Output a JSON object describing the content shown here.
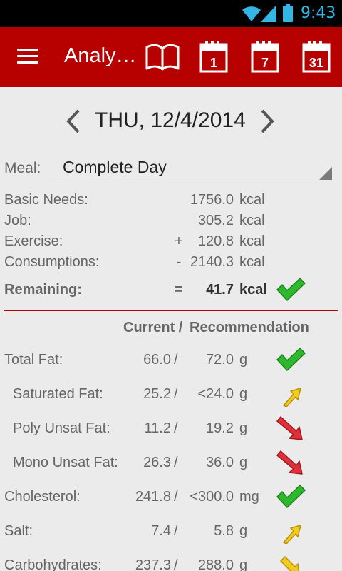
{
  "status_bar": {
    "time": "9:43",
    "icons": [
      "wifi-icon",
      "signal-icon",
      "battery-icon"
    ]
  },
  "action_bar": {
    "title": "Analy…",
    "icons": [
      "menu-icon",
      "book-icon",
      "calendar-day-icon",
      "calendar-week-icon",
      "calendar-month-icon"
    ],
    "cal_day": "1",
    "cal_week": "7",
    "cal_month": "31"
  },
  "date_nav": {
    "date": "THU, 12/4/2014"
  },
  "meal": {
    "label": "Meal:",
    "value": "Complete Day"
  },
  "balance": [
    {
      "label": "Basic Needs:",
      "sign": "",
      "value": "1756.0",
      "unit": "kcal"
    },
    {
      "label": "Job:",
      "sign": "",
      "value": "305.2",
      "unit": "kcal"
    },
    {
      "label": "Exercise:",
      "sign": "+",
      "value": "120.8",
      "unit": "kcal"
    },
    {
      "label": "Consumptions:",
      "sign": "-",
      "value": "2140.3",
      "unit": "kcal"
    },
    {
      "label": "Remaining:",
      "sign": "=",
      "value": "41.7",
      "unit": "kcal",
      "status": "good"
    }
  ],
  "columns": {
    "current": "Current /",
    "recommendation": "Recommendation"
  },
  "nutrients": [
    {
      "label": "Total Fat:",
      "current": "66.0",
      "recommended": "72.0",
      "unit": "g",
      "status": "good"
    },
    {
      "label": "Saturated Fat:",
      "current": "25.2",
      "recommended": "<24.0",
      "unit": "g",
      "status": "slightly-high"
    },
    {
      "label": "Poly Unsat Fat:",
      "current": "11.2",
      "recommended": "19.2",
      "unit": "g",
      "status": "low"
    },
    {
      "label": "Mono Unsat Fat:",
      "current": "26.3",
      "recommended": "36.0",
      "unit": "g",
      "status": "low"
    },
    {
      "label": "Cholesterol:",
      "current": "241.8",
      "recommended": "<300.0",
      "unit": "mg",
      "status": "good"
    },
    {
      "label": "Salt:",
      "current": "7.4",
      "recommended": "5.8",
      "unit": "g",
      "status": "slightly-high"
    },
    {
      "label": "Carbohydrates:",
      "current": "237.3",
      "recommended": "288.0",
      "unit": "g",
      "status": "slightly-low"
    }
  ],
  "colors": {
    "accent": "#b70000",
    "good": "#2eb82e",
    "warning": "#f2cc1a",
    "bad": "#e0303a"
  }
}
